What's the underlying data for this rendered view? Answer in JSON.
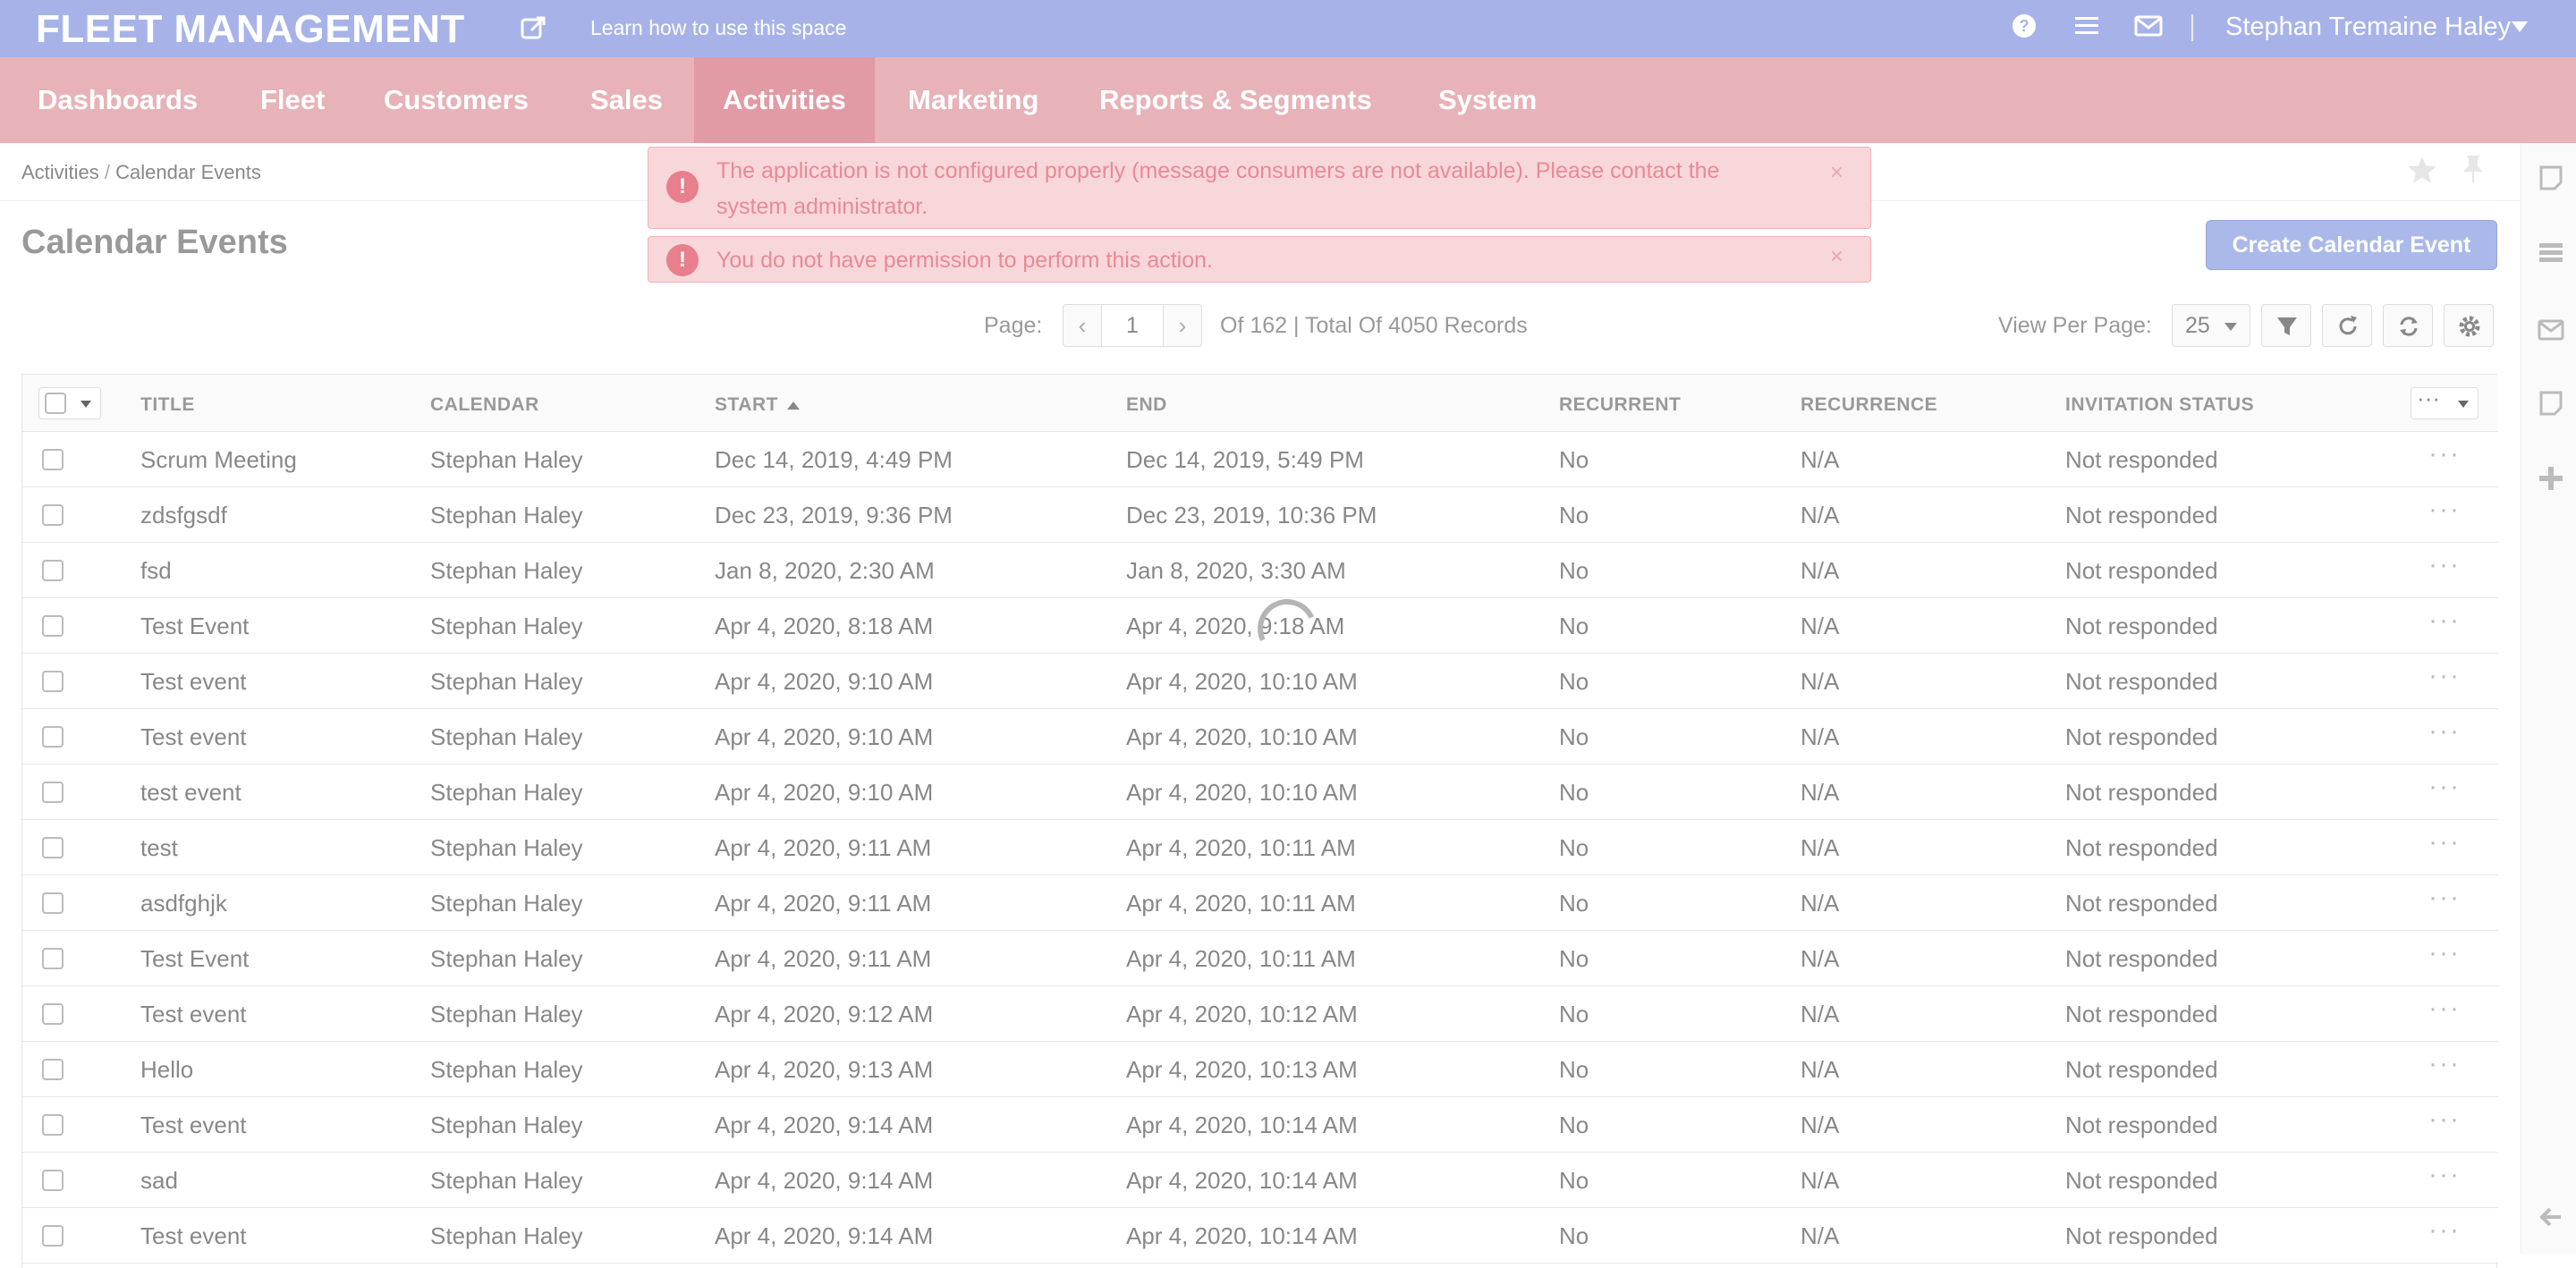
{
  "app": {
    "title": "FLEET MANAGEMENT",
    "help_link": "Learn how to use this space",
    "user_name": "Stephan Tremaine Haley"
  },
  "nav": {
    "items": [
      {
        "label": "Dashboards"
      },
      {
        "label": "Fleet"
      },
      {
        "label": "Customers"
      },
      {
        "label": "Sales"
      },
      {
        "label": "Activities",
        "active": true
      },
      {
        "label": "Marketing"
      },
      {
        "label": "Reports & Segments"
      },
      {
        "label": "System"
      }
    ]
  },
  "breadcrumb": {
    "parent": "Activities",
    "separator": "/",
    "current": "Calendar Events"
  },
  "page": {
    "title": "Calendar Events",
    "create_button": "Create Calendar Event"
  },
  "alerts": [
    {
      "text": "The application is not configured properly (message consumers are not available). Please contact the system administrator.",
      "close": "×"
    },
    {
      "text": "You do not have permission to perform this action.",
      "close": "×"
    }
  ],
  "pager": {
    "label": "Page:",
    "current_page": "1",
    "total_text": "Of 162 | Total Of 4050 Records",
    "view_per_page_label": "View Per Page:",
    "per_page": "25"
  },
  "table": {
    "columns": [
      "TITLE",
      "CALENDAR",
      "START",
      "END",
      "RECURRENT",
      "RECURRENCE",
      "INVITATION STATUS"
    ],
    "row_actions": "···",
    "header_actions": "···",
    "rows": [
      {
        "title": "Scrum Meeting",
        "calendar": "Stephan Haley",
        "start": "Dec 14, 2019, 4:49 PM",
        "end": "Dec 14, 2019, 5:49 PM",
        "recurrent": "No",
        "recurrence": "N/A",
        "status": "Not responded"
      },
      {
        "title": "zdsfgsdf",
        "calendar": "Stephan Haley",
        "start": "Dec 23, 2019, 9:36 PM",
        "end": "Dec 23, 2019, 10:36 PM",
        "recurrent": "No",
        "recurrence": "N/A",
        "status": "Not responded"
      },
      {
        "title": "fsd",
        "calendar": "Stephan Haley",
        "start": "Jan 8, 2020, 2:30 AM",
        "end": "Jan 8, 2020, 3:30 AM",
        "recurrent": "No",
        "recurrence": "N/A",
        "status": "Not responded"
      },
      {
        "title": "Test Event",
        "calendar": "Stephan Haley",
        "start": "Apr 4, 2020, 8:18 AM",
        "end": "Apr 4, 2020, 9:18 AM",
        "recurrent": "No",
        "recurrence": "N/A",
        "status": "Not responded"
      },
      {
        "title": "Test event",
        "calendar": "Stephan Haley",
        "start": "Apr 4, 2020, 9:10 AM",
        "end": "Apr 4, 2020, 10:10 AM",
        "recurrent": "No",
        "recurrence": "N/A",
        "status": "Not responded"
      },
      {
        "title": "Test event",
        "calendar": "Stephan Haley",
        "start": "Apr 4, 2020, 9:10 AM",
        "end": "Apr 4, 2020, 10:10 AM",
        "recurrent": "No",
        "recurrence": "N/A",
        "status": "Not responded"
      },
      {
        "title": "test event",
        "calendar": "Stephan Haley",
        "start": "Apr 4, 2020, 9:10 AM",
        "end": "Apr 4, 2020, 10:10 AM",
        "recurrent": "No",
        "recurrence": "N/A",
        "status": "Not responded"
      },
      {
        "title": "test",
        "calendar": "Stephan Haley",
        "start": "Apr 4, 2020, 9:11 AM",
        "end": "Apr 4, 2020, 10:11 AM",
        "recurrent": "No",
        "recurrence": "N/A",
        "status": "Not responded"
      },
      {
        "title": "asdfghjk",
        "calendar": "Stephan Haley",
        "start": "Apr 4, 2020, 9:11 AM",
        "end": "Apr 4, 2020, 10:11 AM",
        "recurrent": "No",
        "recurrence": "N/A",
        "status": "Not responded"
      },
      {
        "title": "Test Event",
        "calendar": "Stephan Haley",
        "start": "Apr 4, 2020, 9:11 AM",
        "end": "Apr 4, 2020, 10:11 AM",
        "recurrent": "No",
        "recurrence": "N/A",
        "status": "Not responded"
      },
      {
        "title": "Test event",
        "calendar": "Stephan Haley",
        "start": "Apr 4, 2020, 9:12 AM",
        "end": "Apr 4, 2020, 10:12 AM",
        "recurrent": "No",
        "recurrence": "N/A",
        "status": "Not responded"
      },
      {
        "title": "Hello",
        "calendar": "Stephan Haley",
        "start": "Apr 4, 2020, 9:13 AM",
        "end": "Apr 4, 2020, 10:13 AM",
        "recurrent": "No",
        "recurrence": "N/A",
        "status": "Not responded"
      },
      {
        "title": "Test event",
        "calendar": "Stephan Haley",
        "start": "Apr 4, 2020, 9:14 AM",
        "end": "Apr 4, 2020, 10:14 AM",
        "recurrent": "No",
        "recurrence": "N/A",
        "status": "Not responded"
      },
      {
        "title": "sad",
        "calendar": "Stephan Haley",
        "start": "Apr 4, 2020, 9:14 AM",
        "end": "Apr 4, 2020, 10:14 AM",
        "recurrent": "No",
        "recurrence": "N/A",
        "status": "Not responded"
      },
      {
        "title": "Test event",
        "calendar": "Stephan Haley",
        "start": "Apr 4, 2020, 9:14 AM",
        "end": "Apr 4, 2020, 10:14 AM",
        "recurrent": "No",
        "recurrence": "N/A",
        "status": "Not responded"
      }
    ]
  },
  "icons": {
    "top": [
      "help-icon",
      "menu-icon",
      "mail-icon"
    ],
    "sidebar": [
      "note-icon",
      "tasks-icon",
      "mail-icon",
      "note-add-icon",
      "plus-icon",
      "back-arrow-icon"
    ],
    "toolbar": [
      "filter-icon",
      "refresh-icon",
      "reset-icon",
      "settings-icon"
    ]
  },
  "colors": {
    "topbar": "#a7b3e8",
    "navbar": "#e7b2b8",
    "nav_active": "#e29aa4",
    "primary_button": "#aab9ea",
    "alert_bg": "#f8d7da",
    "alert_text": "#e88a95"
  }
}
